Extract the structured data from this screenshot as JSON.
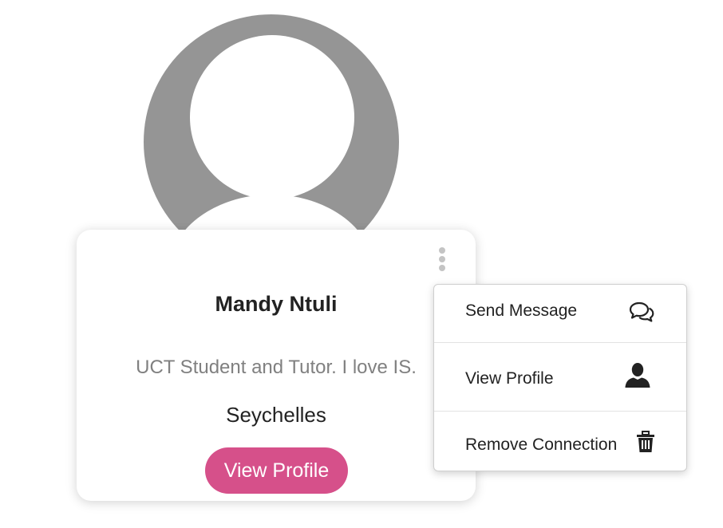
{
  "profile": {
    "name": "Mandy Ntuli",
    "bio": "UCT Student and Tutor. I love IS.",
    "location": "Seychelles",
    "view_profile_button": "View Profile"
  },
  "menu": {
    "items": [
      {
        "label": "Send Message",
        "icon": "chat-bubbles-icon"
      },
      {
        "label": "View Profile",
        "icon": "user-icon"
      },
      {
        "label": "Remove Connection",
        "icon": "trash-icon"
      }
    ]
  },
  "colors": {
    "accent": "#d6508a",
    "avatar_placeholder": "#959595"
  }
}
